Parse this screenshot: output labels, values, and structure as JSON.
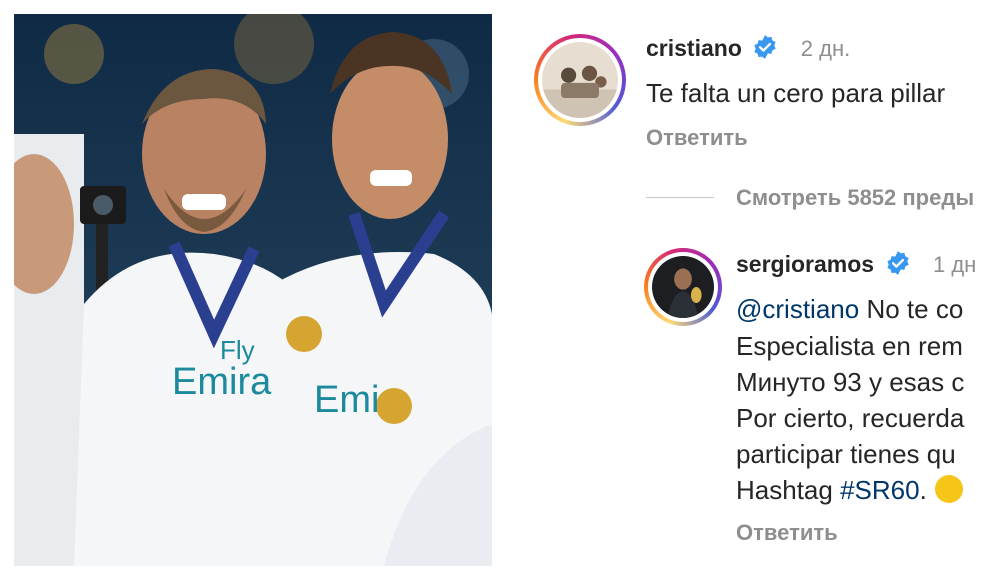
{
  "post": {
    "photo_label": "",
    "jersey_text": "Fly Emirates"
  },
  "comments": [
    {
      "username": "cristiano",
      "verified": true,
      "time": "2 дн.",
      "text": "Te falta un cero para pillar",
      "reply_label": "Ответить"
    }
  ],
  "view_replies_label": "Смотреть 5852 преды",
  "reply": {
    "username": "sergioramos",
    "verified": true,
    "time": "1 дн",
    "mention": "@cristiano",
    "line1_rest": "No te co",
    "line2": "Especialista en rem",
    "line3": "Минуто 93 y esas c",
    "line4": "Por cierto, recuerda",
    "line5": "participar tienes qu",
    "line6_prefix": "Hashtag ",
    "hashtag": "#SR60",
    "line6_suffix": ".",
    "reply_label": "Ответить"
  },
  "colors": {
    "verified_blue": "#3897f0",
    "link_blue": "#00376b",
    "muted_gray": "#8e8e8e"
  }
}
